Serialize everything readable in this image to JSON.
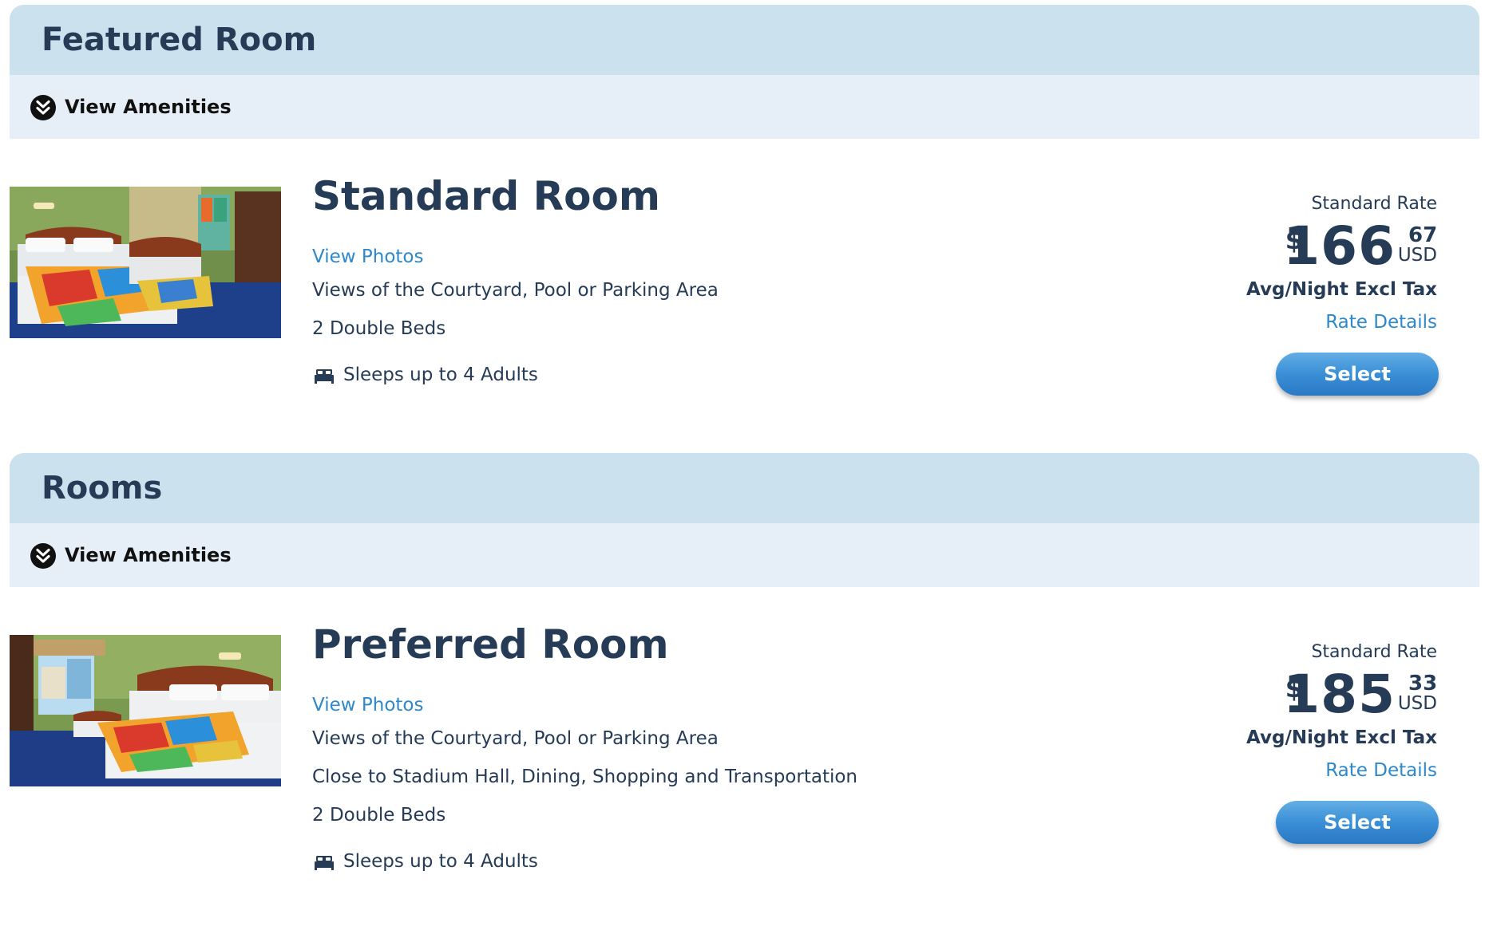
{
  "sections": [
    {
      "title": "Featured Room",
      "amenities_label": "View Amenities",
      "rooms": [
        {
          "name": "Standard Room",
          "view_photos": "View Photos",
          "details": [
            "Views of the Courtyard, Pool or Parking Area",
            "2 Double Beds"
          ],
          "sleeps": "Sleeps up to 4 Adults",
          "rate_label": "Standard Rate",
          "price": {
            "currency_symbol": "$",
            "whole": "166",
            "cents": "67",
            "currency": "USD"
          },
          "avg_night": "Avg/Night Excl Tax",
          "rate_details": "Rate Details",
          "select_label": "Select"
        }
      ]
    },
    {
      "title": "Rooms",
      "amenities_label": "View Amenities",
      "rooms": [
        {
          "name": "Preferred Room",
          "view_photos": "View Photos",
          "details": [
            "Views of the Courtyard, Pool or Parking Area",
            "Close to Stadium Hall, Dining, Shopping and Transportation",
            "2 Double Beds"
          ],
          "sleeps": "Sleeps up to 4 Adults",
          "rate_label": "Standard Rate",
          "price": {
            "currency_symbol": "$",
            "whole": "185",
            "cents": "33",
            "currency": "USD"
          },
          "avg_night": "Avg/Night Excl Tax",
          "rate_details": "Rate Details",
          "select_label": "Select"
        }
      ]
    }
  ],
  "icons": {
    "amenities_toggle": "double-chevron-down-icon",
    "sleeps": "bed-icon"
  },
  "colors": {
    "header_bg": "#cce1ee",
    "amenities_bg": "#e6eef7",
    "heading_text": "#253b56",
    "link": "#2d88cc",
    "button": "#3a8fd6"
  }
}
